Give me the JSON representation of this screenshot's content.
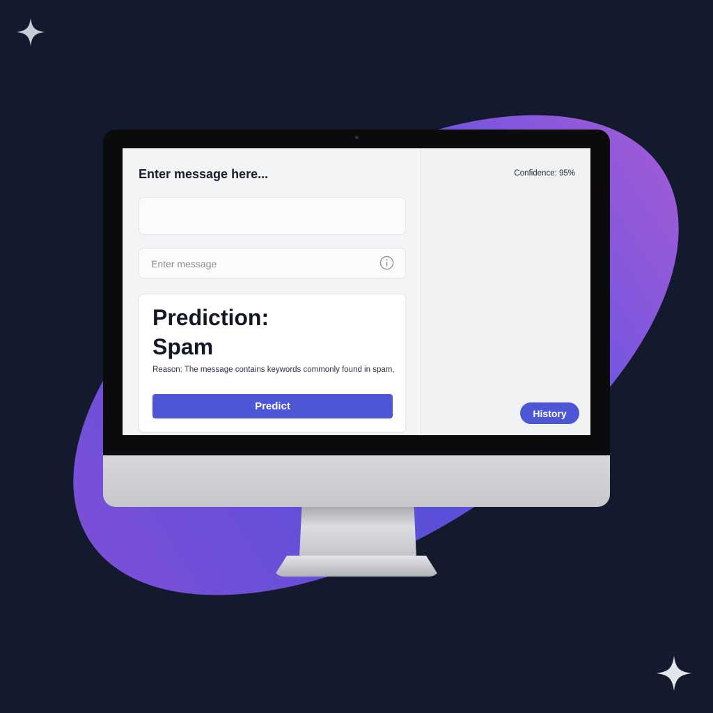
{
  "app": {
    "heading": "Enter message here...",
    "confidence_label": "Confidence: 95%",
    "confidence_value": 0.95
  },
  "form": {
    "blank_field_value": "",
    "message_input": {
      "value": "",
      "placeholder": "Enter message"
    },
    "info_icon": "info-circle-icon"
  },
  "result": {
    "prediction_line1": "Prediction:",
    "prediction_line2": "Spam",
    "reason": "Reason: The message contains keywords commonly found in spam,"
  },
  "buttons": {
    "predict_label": "Predict",
    "history_label": "History"
  },
  "decor": {
    "sparkle_icon": "four-point-star-icon"
  },
  "colors": {
    "accent": "#4d56d4",
    "background": "#141a2e",
    "blob_start": "#7a4fd8",
    "blob_end": "#9c5ad8",
    "screen": "#f3f4f6"
  }
}
